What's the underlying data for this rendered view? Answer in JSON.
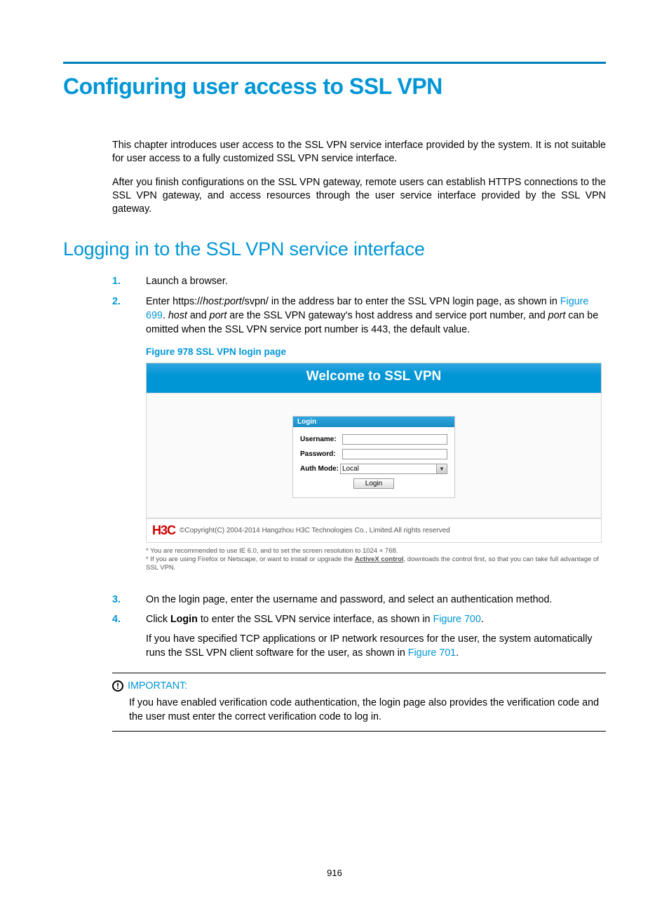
{
  "chapter_title": "Configuring user access to SSL VPN",
  "intro_p1": "This chapter introduces user access to the SSL VPN service interface provided by the system. It is not suitable for user access to a fully customized SSL VPN service interface.",
  "intro_p2": "After you finish configurations on the SSL VPN gateway, remote users can establish HTTPS connections to the SSL VPN gateway, and access resources through the user service interface provided by the SSL VPN gateway.",
  "section_title": "Logging in to the SSL VPN service interface",
  "steps": {
    "s1": {
      "num": "1.",
      "text": "Launch a browser."
    },
    "s2": {
      "num": "2.",
      "pre": "Enter https://",
      "hostport": "host:port",
      "mid1": "/svpn/ in the address bar to enter the SSL VPN login page, as shown in ",
      "link1": "Figure 699",
      "mid2": ". ",
      "host_i": "host",
      "mid3": " and ",
      "port_i": "port",
      "mid4": " are the SSL VPN gateway's host address and service port number, and ",
      "port_i2": "port",
      "tail": " can be omitted when the SSL VPN service port number is 443, the default value."
    },
    "s3": {
      "num": "3.",
      "text": "On the login page, enter the username and password, and select an authentication method."
    },
    "s4": {
      "num": "4.",
      "pre": "Click ",
      "login_b": "Login",
      "mid1": " to enter the SSL VPN service interface, as shown in ",
      "link1": "Figure 700",
      "tail": ".",
      "sub_pre": "If you have specified TCP applications or IP network resources for the user, the system automatically runs the SSL VPN client software for the user, as shown in ",
      "sub_link": "Figure 701",
      "sub_tail": "."
    }
  },
  "figure_caption": "Figure 978 SSL VPN login page",
  "screenshot": {
    "banner": "Welcome to SSL VPN",
    "login_head": "Login",
    "username_label": "Username:",
    "password_label": "Password:",
    "authmode_label": "Auth Mode:",
    "authmode_value": "Local",
    "login_button": "Login",
    "logo": "H3C",
    "copyright": "©Copyright(C) 2004-2014 Hangzhou H3C Technologies Co., Limited.All rights reserved",
    "note1": "* You are recommended to use IE 6.0, and to set the screen resolution to 1024 × 768.",
    "note2_pre": "* If you are using Firefox or Netscape, or want to install or upgrade the ",
    "note2_link": "ActiveX control",
    "note2_tail": ", downloads the control first, so that you can take full advantage of SSL VPN."
  },
  "important": {
    "label": "IMPORTANT:",
    "body": "If you have enabled verification code authentication, the login page also provides the verification code and the user must enter the correct verification code to log in."
  },
  "page_number": "916"
}
